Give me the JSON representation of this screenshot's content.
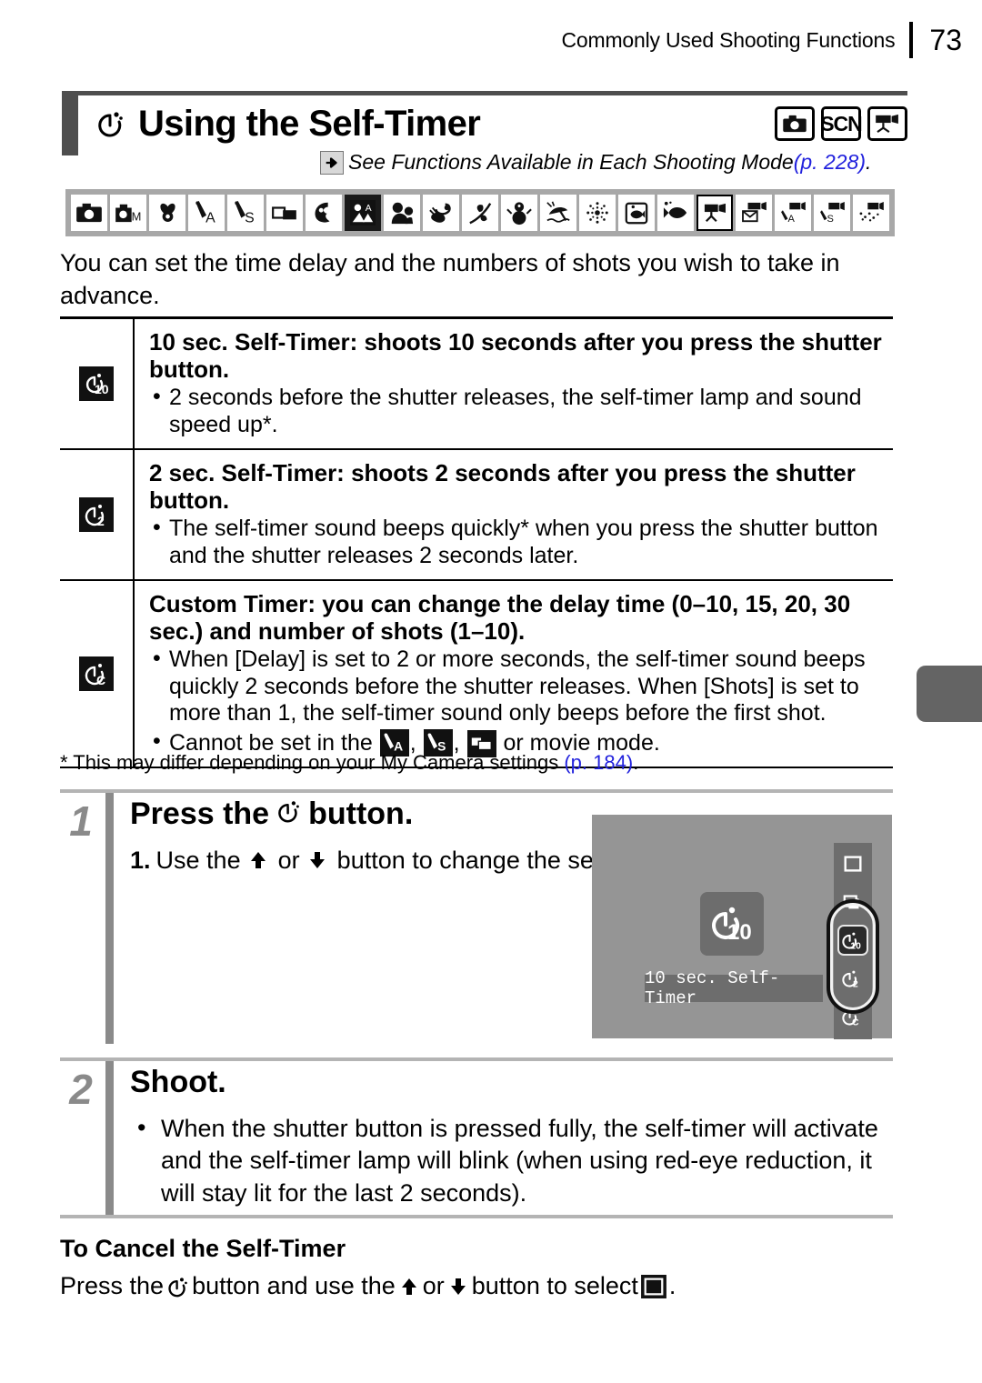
{
  "header": {
    "title": "Commonly Used Shooting Functions",
    "page_number": "73"
  },
  "section": {
    "icon": "self-timer-icon",
    "title": "Using the Self-Timer",
    "mode_badges": [
      {
        "name": "camera-mode-badge",
        "label": ""
      },
      {
        "name": "scn-mode-badge",
        "label": "SCN"
      },
      {
        "name": "movie-mode-badge",
        "label": ""
      }
    ]
  },
  "see_also": {
    "arrow_icon": "right-arrow-icon",
    "text": "See Functions Available in Each Shooting Mode ",
    "link": "(p. 228)",
    "trailing": "."
  },
  "mode_strip": [
    "auto-mode-icon",
    "manual-mode-icon",
    "digital-macro-icon",
    "aperture-priority-icon",
    "shutter-priority-icon",
    "stitch-assist-icon",
    "portrait-icon",
    "night-snapshot-icon",
    "kids-and-pets-icon",
    "indoor-icon",
    "foliage-icon",
    "snow-icon",
    "beach-icon",
    "fireworks-icon",
    "aquarium-icon",
    "underwater-icon",
    "movie-standard-icon",
    "movie-compact-icon",
    "movie-aperture-icon",
    "movie-shutter-icon",
    "movie-color-icon"
  ],
  "intro": "You can set the time delay and the numbers of shots you wish to take in advance.",
  "table": {
    "rows": [
      {
        "icon": "self-timer-10sec-icon",
        "heading": "10 sec. Self-Timer: shoots 10 seconds after you press the shutter button.",
        "bullets": [
          "2 seconds before the shutter releases, the self-timer lamp and sound speed up*."
        ]
      },
      {
        "icon": "self-timer-2sec-icon",
        "heading": "2 sec. Self-Timer: shoots 2 seconds after you press the shutter button.",
        "bullets": [
          "The self-timer sound beeps quickly* when you press the shutter button and the shutter releases 2 seconds later."
        ]
      },
      {
        "icon": "self-timer-custom-icon",
        "heading": "Custom Timer: you can change the delay time (0–10, 15, 20, 30 sec.) and number of shots (1–10).",
        "bullets": [
          "When [Delay] is set to 2 or more seconds, the self-timer sound beeps quickly 2 seconds before the shutter releases. When [Shots] is set to more than 1, the self-timer sound only beeps before the first shot.",
          "Cannot be set in the"
        ],
        "bullet2_tail": "or movie mode."
      }
    ]
  },
  "footnote": {
    "text": "* This may differ depending on your My Camera settings ",
    "link": "(p. 184)",
    "trailing": "."
  },
  "step1": {
    "number": "1",
    "title_pre": "Press the",
    "title_icon": "self-timer-icon",
    "title_post": "button.",
    "sub_number": "1.",
    "sub_pre": "Use the",
    "up_icon": "up-arrow-icon",
    "sub_mid": "or",
    "down_icon": "down-arrow-icon",
    "sub_post": "button to change the self-timer mode."
  },
  "lcd": {
    "selected_icon": "self-timer-10sec-icon",
    "label": "10 sec. Self-Timer",
    "menu": [
      {
        "name": "lcd-menu-single-shot",
        "icon": "single-shot-icon"
      },
      {
        "name": "lcd-menu-continuous",
        "icon": "continuous-shot-icon"
      },
      {
        "name": "lcd-menu-timer-10",
        "icon": "self-timer-10sec-icon",
        "selected": true
      },
      {
        "name": "lcd-menu-timer-2",
        "icon": "self-timer-2sec-icon",
        "selected": false
      },
      {
        "name": "lcd-menu-timer-custom",
        "icon": "self-timer-custom-icon",
        "selected": false
      }
    ]
  },
  "step2": {
    "number": "2",
    "title": "Shoot.",
    "bullets": [
      "When the shutter button is pressed fully, the self-timer will activate and the self-timer lamp will blink (when using red-eye reduction, it will stay lit for the last 2 seconds)."
    ]
  },
  "cancel": {
    "title": "To Cancel the Self-Timer",
    "pre": "Press the",
    "timer_icon": "self-timer-icon",
    "mid1": "button and use the",
    "up_icon": "up-arrow-icon",
    "mid2": "or",
    "down_icon": "down-arrow-icon",
    "mid3": "button to select",
    "select_icon": "single-shot-icon",
    "tail": "."
  },
  "colors": {
    "accent_gray": "#4e4e4e",
    "step_gray": "#8a8a8a",
    "strip_gray": "#a8a8a8",
    "link_blue": "#2222dd",
    "lcd_bg": "#959595",
    "lcd_panel": "#6d6d6d"
  }
}
